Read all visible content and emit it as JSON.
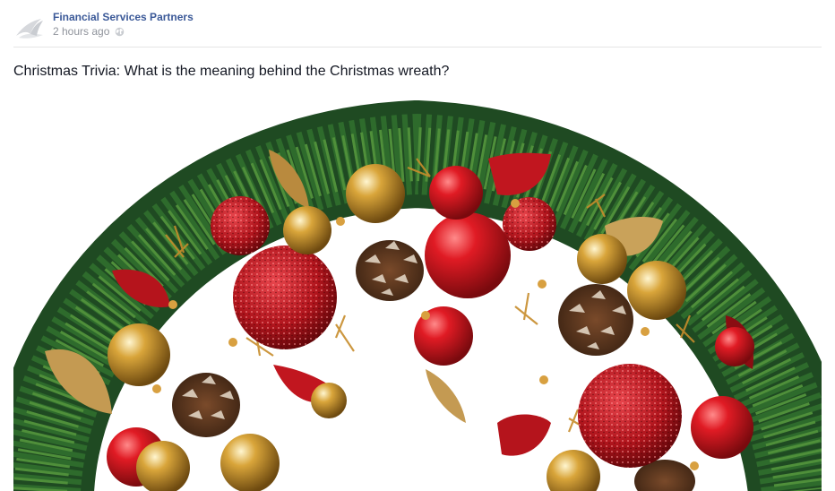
{
  "post": {
    "author": "Financial Services Partners",
    "timestamp": "2 hours ago",
    "privacy_icon": "globe-icon",
    "avatar_icon": "company-logo-icon",
    "text": "Christmas Trivia: What is the meaning behind the Christmas wreath?",
    "photo_subject": "christmas-wreath-photo"
  },
  "colors": {
    "link_blue": "#3b5998",
    "meta_gray": "#90949c",
    "text": "#141823",
    "divider": "#e5e5e5"
  }
}
